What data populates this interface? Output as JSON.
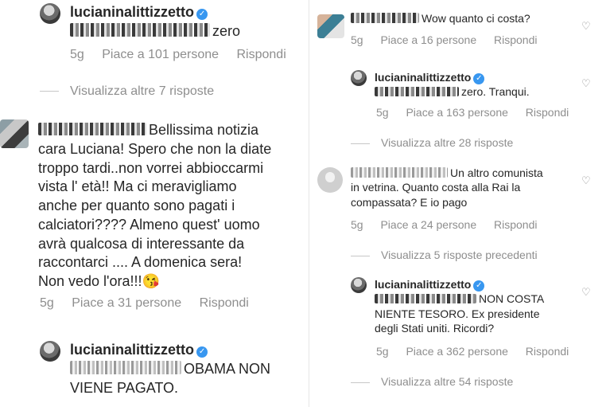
{
  "left": {
    "c1": {
      "username": "lucianinalittizzetto",
      "text": "zero",
      "age": "5g",
      "likes": "Piace a 101 persone",
      "reply": "Rispondi"
    },
    "c1_more": "Visualizza altre 7 risposte",
    "c2": {
      "text_l1": "Bellissima notizia",
      "text_rest": [
        "cara Luciana! Spero che non la diate",
        "troppo tardi..non vorrei abbioccarmi",
        "vista l' età!! Ma ci meravigliamo",
        "anche per quanto sono pagati i",
        "calciatori???? Almeno quest' uomo",
        "avrà qualcosa di interessante da",
        "raccontarci .... A domenica sera!",
        "Non vedo l'ora!!!😘"
      ],
      "age": "5g",
      "likes": "Piace a 31 persone",
      "reply": "Rispondi"
    },
    "c3": {
      "username": "lucianinalittizzetto",
      "text_l1": "OBAMA NON",
      "text_l2": "VIENE PAGATO."
    }
  },
  "right": {
    "c1": {
      "text": "Wow quanto ci costa?",
      "age": "5g",
      "likes": "Piace a 16 persone",
      "reply": "Rispondi"
    },
    "c2": {
      "username": "lucianinalittizzetto",
      "text": "zero. Tranqui.",
      "age": "5g",
      "likes": "Piace a 163 persone",
      "reply": "Rispondi"
    },
    "c2_more": "Visualizza altre 28 risposte",
    "c3": {
      "text_l1": "Un altro comunista",
      "text_l2": "in vetrina. Quanto costa alla Rai la",
      "text_l3": "compassata? E io pago",
      "age": "5g",
      "likes": "Piace a 24 persone",
      "reply": "Rispondi"
    },
    "c3_more": "Visualizza 5 risposte precedenti",
    "c4": {
      "username": "lucianinalittizzetto",
      "text_l1": "NON COSTA",
      "text_l2": "NIENTE TESORO. Ex presidente",
      "text_l3": "degli Stati uniti. Ricordi?",
      "age": "5g",
      "likes": "Piace a 362 persone",
      "reply": "Rispondi"
    },
    "c4_more": "Visualizza altre 54 risposte"
  },
  "icons": {
    "verified": "verified-badge-icon",
    "like": "heart-outline-icon"
  },
  "colors": {
    "verified": "#3897f0",
    "meta": "#8e8e8e",
    "text": "#262626"
  }
}
